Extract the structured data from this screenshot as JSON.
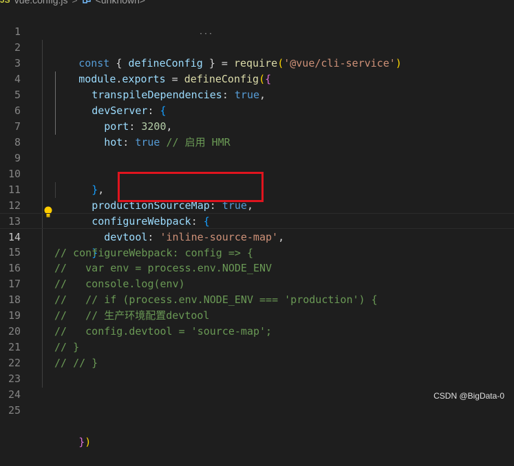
{
  "breadcrumb": {
    "file_icon": "JS",
    "file": "vue.config.js",
    "separator": ">",
    "symbol_icon": "symbol-icon",
    "symbol": "<unknown>"
  },
  "line_numbers": [
    "1",
    "2",
    "3",
    "4",
    "5",
    "6",
    "7",
    "8",
    "9",
    "10",
    "11",
    "12",
    "13",
    "14",
    "15",
    "16",
    "17",
    "18",
    "19",
    "20",
    "21",
    "22",
    "23",
    "24",
    "25"
  ],
  "current_line": "14",
  "code": {
    "l1": [
      "const",
      " { ",
      "defineConfig",
      " } = ",
      "require",
      "(",
      "'@vue/cli-service'",
      ")"
    ],
    "l2": [
      "module",
      ".",
      "exports",
      " = ",
      "defineConfig",
      "(",
      "{"
    ],
    "l3": [
      "transpileDependencies",
      ": ",
      "true",
      ","
    ],
    "l4": [
      "devServer",
      ": ",
      "{"
    ],
    "l5": [
      "port",
      ": ",
      "3200",
      ","
    ],
    "l6": [
      "hot",
      ": ",
      "true",
      " // 启用 HMR"
    ],
    "l9": [
      "}",
      ","
    ],
    "l10": [
      "productionSourceMap",
      ": ",
      "true",
      ","
    ],
    "l11": [
      "configureWebpack",
      ": ",
      "{"
    ],
    "l12": [
      "devtool",
      ": ",
      "'inline-source-map'",
      ","
    ],
    "l13": [
      "}"
    ],
    "l14": "// configureWebpack: config => {",
    "l15": "//   var env = process.env.NODE_ENV",
    "l16": "//   console.log(env)",
    "l17": "//   // if (process.env.NODE_ENV === 'production') {",
    "l18": "//   // 生产环境配置devtool",
    "l19": "//   config.devtool = 'source-map';",
    "l20": "// }",
    "l21": "// // }",
    "l25": [
      "}",
      ")"
    ]
  },
  "colors": {
    "background": "#1e1e1e",
    "keyword": "#569cd6",
    "property": "#9cdcfe",
    "function": "#dcdcaa",
    "string": "#ce9178",
    "number": "#b5cea8",
    "comment": "#6a9955",
    "highlight_box": "#e0141e"
  },
  "watermark": "CSDN @BigData-0"
}
